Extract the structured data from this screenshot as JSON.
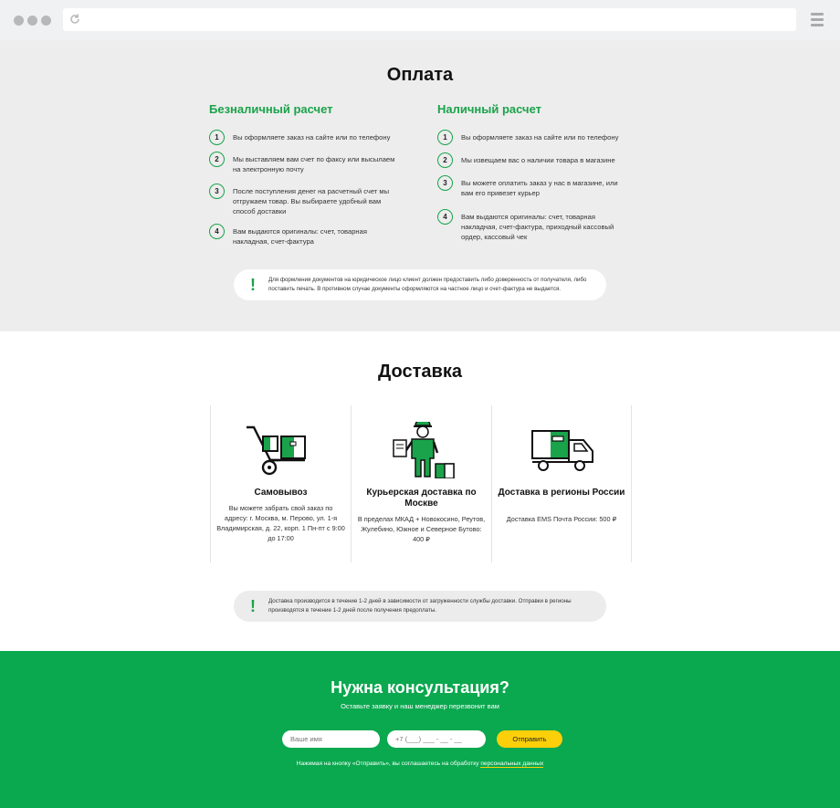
{
  "payment": {
    "title": "Оплата",
    "cashless": {
      "heading": "Безналичный расчет",
      "steps": [
        {
          "n": "1",
          "text": "Вы оформляете заказ на сайте или по телефону"
        },
        {
          "n": "2",
          "text": "Мы выставляем вам счет по факсу или высылаем на электронную почту"
        },
        {
          "n": "3",
          "text": "После поступления денег на расчетный счет мы отгружаем товар. Вы выбираете удобный вам способ доставки"
        },
        {
          "n": "4",
          "text": "Вам выдаются оригиналы: счет, товарная накладная, счет-фактура"
        }
      ]
    },
    "cash": {
      "heading": "Наличный расчет",
      "steps": [
        {
          "n": "1",
          "text": "Вы оформляете заказ на сайте или по телефону"
        },
        {
          "n": "2",
          "text": "Мы извещаем вас о наличии товара в магазине"
        },
        {
          "n": "3",
          "text": "Вы можете оплатить заказ у нас в магазине, или вам его привезет курьер"
        },
        {
          "n": "4",
          "text": "Вам выдаются оригиналы: счет, товарная накладная, счет-фактура, приходный кассовый ордер, кассовый чек"
        }
      ]
    },
    "note": {
      "mark": "!",
      "text": "Для формления документов на юридическое лицо клиент должен предоставить либо доверенность от получателя, либо поставить печать. В противном случае документы оформляются на частное лицо и счет-фактура не выдается."
    }
  },
  "delivery": {
    "title": "Доставка",
    "cards": [
      {
        "icon": "hand-truck-icon",
        "title": "Самовывоз",
        "text": "Вы можете забрать свой заказ по адресу: г. Москва, м. Перово, ул. 1-я Владимирская, д. 22, корп. 1 Пн-пт с 9:00 до 17:00"
      },
      {
        "icon": "courier-icon",
        "title": "Курьерская доставка по Москве",
        "text": "В пределах МКАД + Новокосино, Реутов, Жулебино, Южное и Северное Бутово: 400 ₽"
      },
      {
        "icon": "truck-icon",
        "title": "Доставка в регионы России",
        "text": "Доставка EMS Почта России: 500 ₽"
      }
    ],
    "note": {
      "mark": "!",
      "text": "Доставка производится в течение 1-2 дней в зависимости от загруженности службы доставки. Отправки в регионы производятся в течение 1-2 дней после получения предоплаты."
    }
  },
  "consult": {
    "title": "Нужна консультация?",
    "subtitle": "Оставьте заявку и наш менеджер перезвонит вам",
    "name_placeholder": "Ваше имя",
    "phone_placeholder": "+7 (___) ___ - __ - __",
    "submit_label": "Отправить",
    "agree_text": "Нажимая на кнопку «Отправить», вы соглашаетесь на обработку",
    "agree_link": "персональных данных"
  },
  "colors": {
    "accent": "#1aa34a",
    "band": "#0aa84f",
    "button": "#fbcf09",
    "gray_bg": "#ededed"
  }
}
